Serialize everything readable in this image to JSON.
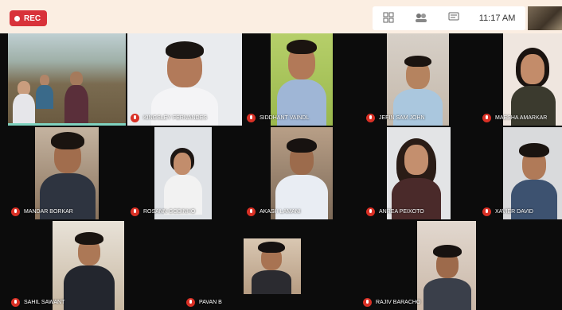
{
  "recording": {
    "label": "REC"
  },
  "toolbar": {
    "time": "11:17 AM"
  },
  "participants": [
    {
      "name": "KINGSLEY FERNANDES"
    },
    {
      "name": "SIDDHANT VAINDL"
    },
    {
      "name": "JEFIN SAM JOHN"
    },
    {
      "name": "MAESHA AMARKAR"
    },
    {
      "name": "MANDAR BORKAR"
    },
    {
      "name": "ROSANN GODINHO"
    },
    {
      "name": "AKASH LAMANI"
    },
    {
      "name": "ANREA PEIXOTO"
    },
    {
      "name": "XAVIER DAVID"
    },
    {
      "name": "SAHIL SAWANT"
    },
    {
      "name": "PAVAN B"
    },
    {
      "name": "RAJIV BARACHO"
    }
  ]
}
